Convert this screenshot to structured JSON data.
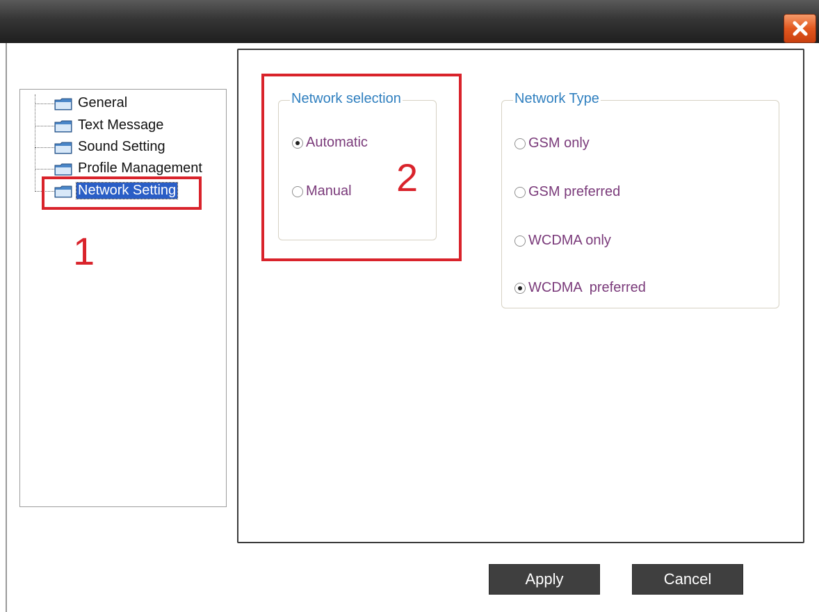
{
  "tree": {
    "items": [
      {
        "label": "General"
      },
      {
        "label": "Text Message"
      },
      {
        "label": "Sound Setting"
      },
      {
        "label": "Profile Management"
      },
      {
        "label": "Network Setting"
      }
    ]
  },
  "network_selection": {
    "title": "Network selection",
    "options": [
      "Automatic",
      "Manual"
    ],
    "selected": "Automatic"
  },
  "network_type": {
    "title": "Network Type",
    "options": [
      "GSM only",
      "GSM preferred",
      "WCDMA only",
      "WCDMA  preferred"
    ],
    "selected": "WCDMA  preferred"
  },
  "annotations": {
    "one": "1",
    "two": "2"
  },
  "buttons": {
    "apply": "Apply",
    "cancel": "Cancel"
  },
  "colors": {
    "annotation_red": "#d9232b",
    "group_title_blue": "#2f7fbf",
    "option_purple": "#7a3a7a"
  }
}
